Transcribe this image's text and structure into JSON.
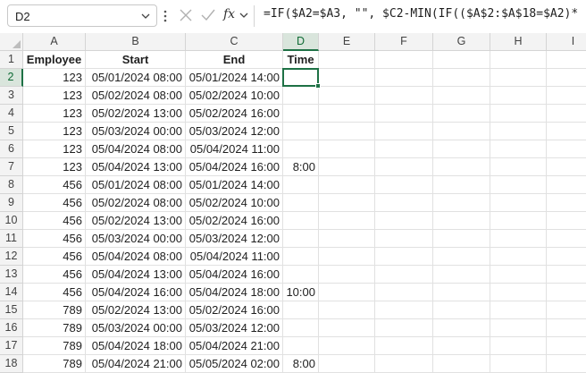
{
  "formula_bar": {
    "name_box": "D2",
    "fx_label": "fx",
    "formula": "=IF($A2=$A3, \"\", $C2-MIN(IF(($A$2:$A$18=$A2)*"
  },
  "columns": [
    "A",
    "B",
    "C",
    "D",
    "E",
    "F",
    "G",
    "H",
    "I"
  ],
  "headers": {
    "a": "Employee",
    "b": "Start",
    "c": "End",
    "d": "Time"
  },
  "rows": [
    {
      "n": "1"
    },
    {
      "n": "2",
      "a": "123",
      "b": "05/01/2024 08:00",
      "c": "05/01/2024 14:00",
      "d": ""
    },
    {
      "n": "3",
      "a": "123",
      "b": "05/02/2024 08:00",
      "c": "05/02/2024 10:00",
      "d": ""
    },
    {
      "n": "4",
      "a": "123",
      "b": "05/02/2024 13:00",
      "c": "05/02/2024 16:00",
      "d": ""
    },
    {
      "n": "5",
      "a": "123",
      "b": "05/03/2024 00:00",
      "c": "05/03/2024 12:00",
      "d": ""
    },
    {
      "n": "6",
      "a": "123",
      "b": "05/04/2024 08:00",
      "c": "05/04/2024 11:00",
      "d": ""
    },
    {
      "n": "7",
      "a": "123",
      "b": "05/04/2024 13:00",
      "c": "05/04/2024 16:00",
      "d": "8:00"
    },
    {
      "n": "8",
      "a": "456",
      "b": "05/01/2024 08:00",
      "c": "05/01/2024 14:00",
      "d": ""
    },
    {
      "n": "9",
      "a": "456",
      "b": "05/02/2024 08:00",
      "c": "05/02/2024 10:00",
      "d": ""
    },
    {
      "n": "10",
      "a": "456",
      "b": "05/02/2024 13:00",
      "c": "05/02/2024 16:00",
      "d": ""
    },
    {
      "n": "11",
      "a": "456",
      "b": "05/03/2024 00:00",
      "c": "05/03/2024 12:00",
      "d": ""
    },
    {
      "n": "12",
      "a": "456",
      "b": "05/04/2024 08:00",
      "c": "05/04/2024 11:00",
      "d": ""
    },
    {
      "n": "13",
      "a": "456",
      "b": "05/04/2024 13:00",
      "c": "05/04/2024 16:00",
      "d": ""
    },
    {
      "n": "14",
      "a": "456",
      "b": "05/04/2024 16:00",
      "c": "05/04/2024 18:00",
      "d": "10:00"
    },
    {
      "n": "15",
      "a": "789",
      "b": "05/02/2024 13:00",
      "c": "05/02/2024 16:00",
      "d": ""
    },
    {
      "n": "16",
      "a": "789",
      "b": "05/03/2024 00:00",
      "c": "05/03/2024 12:00",
      "d": ""
    },
    {
      "n": "17",
      "a": "789",
      "b": "05/04/2024 18:00",
      "c": "05/04/2024 21:00",
      "d": ""
    },
    {
      "n": "18",
      "a": "789",
      "b": "05/04/2024 21:00",
      "c": "05/05/2024 02:00",
      "d": "8:00"
    }
  ],
  "selection": {
    "column": "D",
    "row": "2"
  },
  "colors": {
    "accent": "#1e7145",
    "header_bg": "#f3f3f3",
    "selected_header_bg": "#d9e5dc",
    "gridline": "#e1e1e1"
  }
}
